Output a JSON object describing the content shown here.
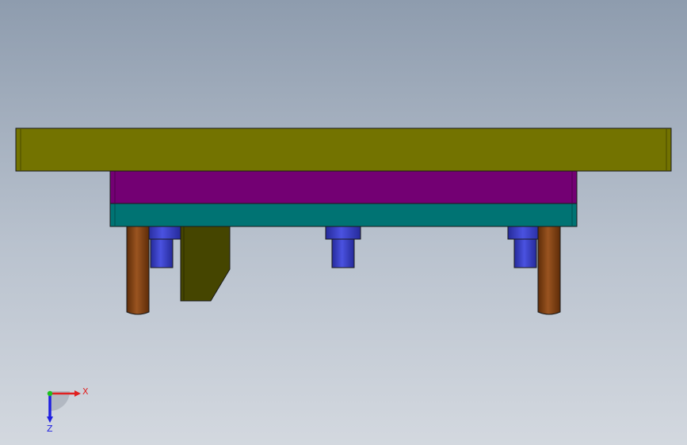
{
  "scene": {
    "view": "front",
    "colors": {
      "background_top": "#8e9cae",
      "background_bottom": "#d3d8df",
      "top_plate": "#737300",
      "middle_plate": "#730073",
      "bottom_plate": "#007373",
      "guide_pin": "#8a4515",
      "bushing": "#3a40c8",
      "bracket": "#454500",
      "edge": "#1a1a1a"
    },
    "parts": {
      "top_plate": "top-plate",
      "middle_plate": "middle-plate",
      "bottom_plate": "bottom-plate",
      "guide_pins": [
        "guide-pin-left",
        "guide-pin-right"
      ],
      "bushings": [
        "bushing-left",
        "bushing-center",
        "bushing-right"
      ],
      "bracket": "bracket"
    }
  },
  "triad": {
    "x_label": "X",
    "z_label": "Z",
    "x_color": "#e02020",
    "y_color": "#20c020",
    "z_color": "#2020e0"
  }
}
